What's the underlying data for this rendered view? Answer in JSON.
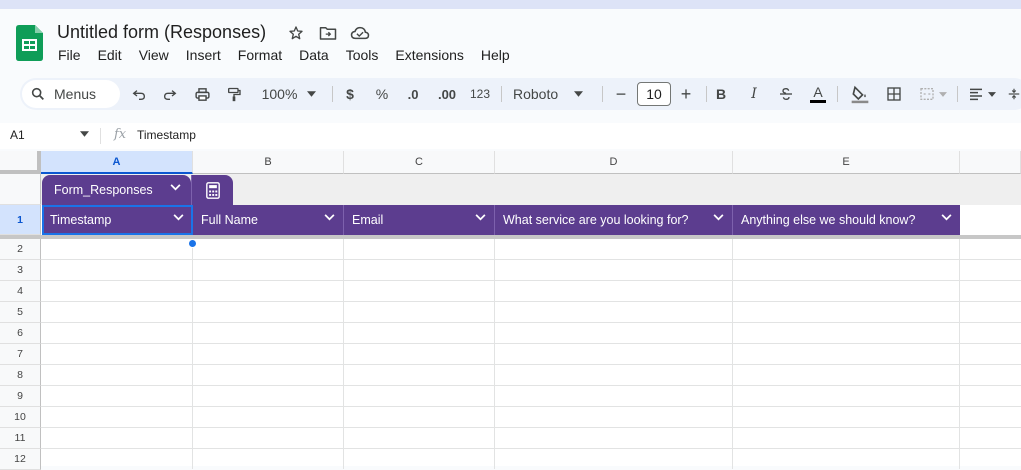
{
  "doc": {
    "title": "Untitled form (Responses)",
    "icons": [
      "star-icon",
      "move-to-folder-icon",
      "cloud-saved-icon"
    ]
  },
  "menu": [
    "File",
    "Edit",
    "View",
    "Insert",
    "Format",
    "Data",
    "Tools",
    "Extensions",
    "Help"
  ],
  "toolbar": {
    "search_label": "Menus",
    "zoom": "100%",
    "currency": "$",
    "percent": "%",
    "decrease_decimal": ".0",
    "increase_decimal": ".00",
    "more_formats": "123",
    "font": "Roboto",
    "font_size": "10",
    "minus": "−",
    "plus": "+",
    "bold": "B",
    "italic": "I",
    "text_color": "A"
  },
  "formula_bar": {
    "cell_ref": "A1",
    "fx": "fx",
    "value": "Timestamp"
  },
  "columns": [
    "A",
    "B",
    "C",
    "D",
    "E"
  ],
  "table": {
    "name": "Form_Responses",
    "headers": [
      "Timestamp",
      "Full Name",
      "Email",
      "What service are you looking for?",
      "Anything else we should know?"
    ],
    "color": "#5c3d8f"
  },
  "rows": [
    "1",
    "2",
    "3",
    "4",
    "5",
    "6",
    "7",
    "8",
    "9",
    "10",
    "11",
    "12"
  ]
}
